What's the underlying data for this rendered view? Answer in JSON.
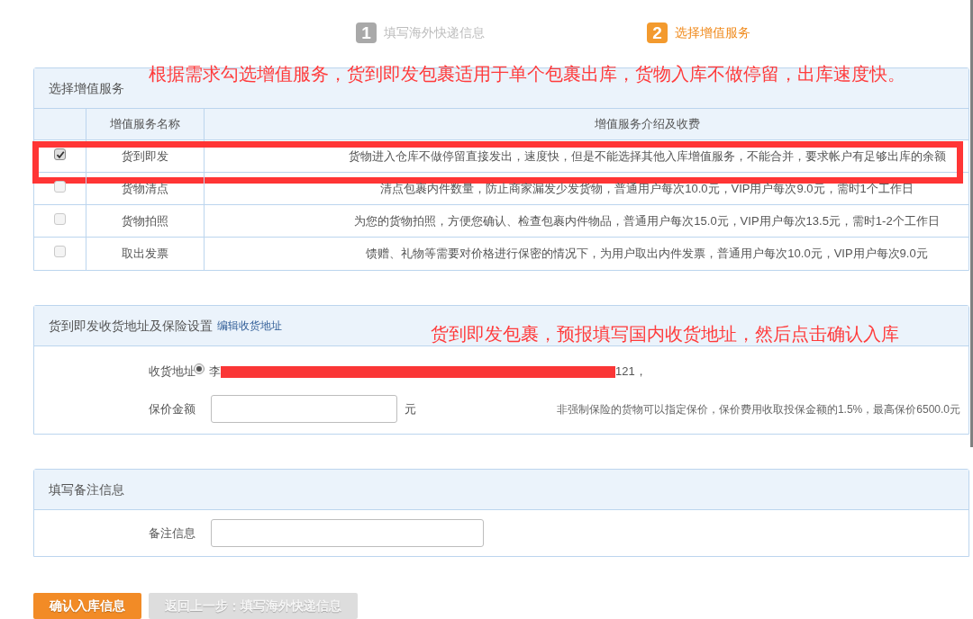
{
  "steps": [
    {
      "number": "1",
      "label": "填写海外快递信息",
      "selected": false
    },
    {
      "number": "2",
      "label": "选择增值服务",
      "selected": true
    }
  ],
  "services_panel": {
    "title": "选择增值服务",
    "annotation": "根据需求勾选增值服务，货到即发包裹适用于单个包裹出库，货物入库不做停留，出库速度快。",
    "columns": [
      "增值服务名称",
      "增值服务介绍及收费"
    ],
    "rows": [
      {
        "name": "货到即发",
        "description": "货物进入仓库不做停留直接发出，速度快，但是不能选择其他入库增值服务，不能合并，要求帐户有足够出库的余额",
        "checked": true,
        "highlighted": true
      },
      {
        "name": "货物清点",
        "description": "清点包裹内件数量，防止商家漏发少发货物，普通用户每次10.0元，VIP用户每次9.0元，需时1个工作日",
        "checked": false,
        "highlighted": false
      },
      {
        "name": "货物拍照",
        "description": "为您的货物拍照，方便您确认、检查包裹内件物品，普通用户每次15.0元，VIP用户每次13.5元，需时1-2个工作日",
        "checked": false,
        "highlighted": false
      },
      {
        "name": "取出发票",
        "description": "馈赠、礼物等需要对价格进行保密的情况下，为用户取出内件发票，普通用户每次10.0元，VIP用户每次9.0元",
        "checked": false,
        "highlighted": false
      }
    ]
  },
  "address_panel": {
    "title": "货到即发收货地址及保险设置",
    "edit_link": "编辑收货地址",
    "annotation": "货到即发包裹，预报填写国内收货地址，然后点击确认入库",
    "address_label": "收货地址",
    "address": {
      "selected": true,
      "start": "李",
      "end": "121，",
      "redacted": true
    },
    "insurance_label": "保价金额",
    "insurance_unit": "元",
    "insurance_note": "非强制保险的货物可以指定保价，保价费用收取投保金额的1.5%，最高保价6500.0元"
  },
  "remarks_panel": {
    "title": "填写备注信息",
    "remarks_label": "备注信息"
  },
  "buttons": [
    {
      "label": "确认入库信息",
      "disabled": false
    },
    {
      "label": "返回上一步：填写海外快递信息",
      "disabled": true
    }
  ]
}
